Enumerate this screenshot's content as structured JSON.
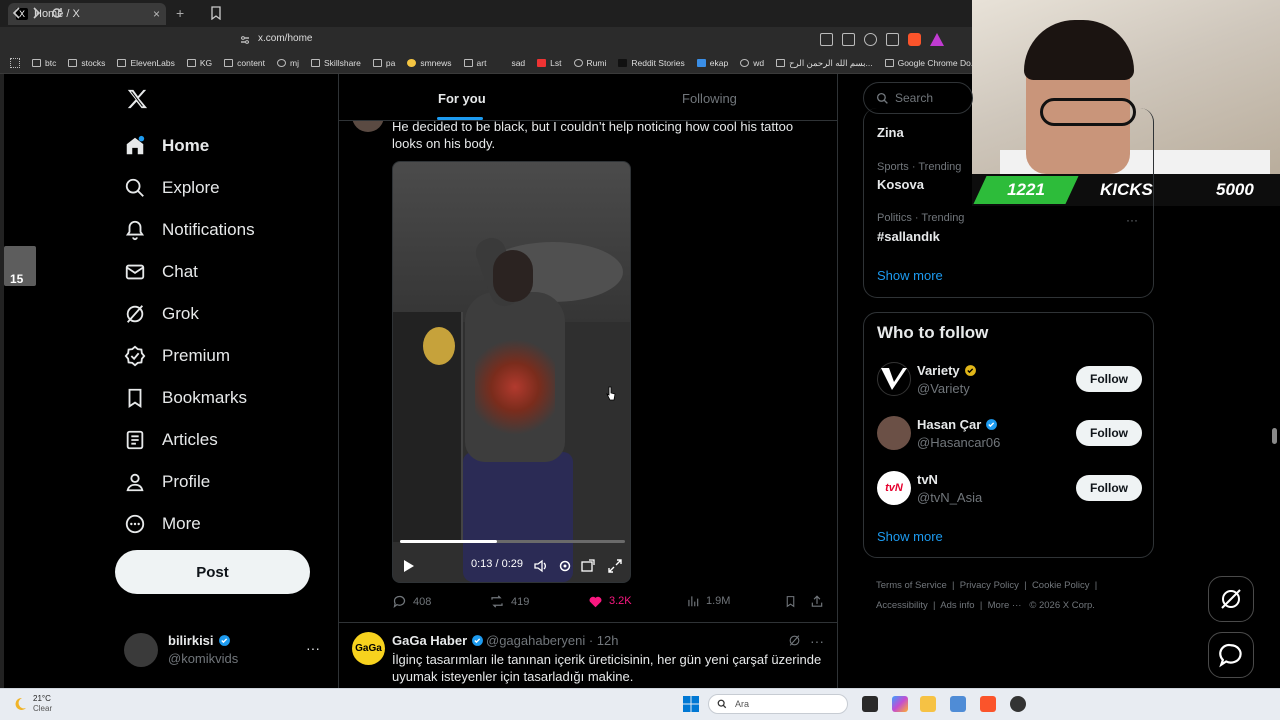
{
  "browser": {
    "tab_title": "Home / X",
    "tab_favicon": "X",
    "tab_close": "×",
    "new_tab": "+",
    "url": "x.com/home",
    "bookmarks": [
      "btc",
      "stocks",
      "ElevenLabs",
      "KG",
      "content",
      "mj",
      "Skillshare",
      "pa",
      "smnews",
      "art",
      "sad",
      "Lst",
      "Rumi",
      "Reddit Stories",
      "ekap",
      "wd",
      "بسم الله الرحمن الرح...",
      "Google Chrome Do..."
    ]
  },
  "stream_overlay": {
    "counter": "1221",
    "label": "KICKS",
    "amount": "5000",
    "colors": {
      "badge": "#2dbc3a"
    }
  },
  "side_thumb": {
    "badge": "15"
  },
  "sidebar": {
    "logo": "X",
    "items": [
      {
        "label": "Home",
        "icon": "home-icon"
      },
      {
        "label": "Explore",
        "icon": "search-icon"
      },
      {
        "label": "Notifications",
        "icon": "bell-icon"
      },
      {
        "label": "Chat",
        "icon": "mail-icon"
      },
      {
        "label": "Grok",
        "icon": "grok-icon"
      },
      {
        "label": "Premium",
        "icon": "verified-icon"
      },
      {
        "label": "Bookmarks",
        "icon": "bookmark-icon"
      },
      {
        "label": "Articles",
        "icon": "article-icon"
      },
      {
        "label": "Profile",
        "icon": "person-icon"
      },
      {
        "label": "More",
        "icon": "more-circle-icon"
      }
    ],
    "post_button": "Post",
    "account": {
      "name": "bilirkisi",
      "handle": "@komikvids",
      "more": "···"
    }
  },
  "feed": {
    "tabs": [
      "For you",
      "Following"
    ],
    "active_tab": "For you",
    "tweet": {
      "text": "He decided to be black, but I couldn’t help noticing how cool his tattoo looks on his body.",
      "video": {
        "time": "0:13 / 0:29",
        "progress": 0.43
      },
      "stats": {
        "replies": "408",
        "reposts": "419",
        "likes": "3.2K",
        "views": "1.9M"
      }
    },
    "tweet2": {
      "name": "GaGa Haber",
      "handle": "@gagahaberyeni · 12h",
      "avatar_text": "GaGa",
      "text": "İlginç tasarımları ile tanınan içerik üreticisinin, her gün yeni çarşaf üzerinde uyumak isteyenler için tasarladığı makine.",
      "more": "···"
    }
  },
  "right": {
    "search_placeholder": "Search",
    "trends": [
      {
        "meta": "",
        "name": "Zina"
      },
      {
        "meta": "Sports · Trending",
        "name": "Kosova"
      },
      {
        "meta": "Politics · Trending",
        "name": "#sallandık"
      }
    ],
    "trends_show_more": "Show more",
    "trend_more": "···",
    "who_to_follow": {
      "title": "Who to follow",
      "users": [
        {
          "name": "Variety",
          "handle": "@Variety",
          "button": "Follow",
          "badge": "gold"
        },
        {
          "name": "Hasan Çar",
          "handle": "@Hasancar06",
          "button": "Follow",
          "badge": "blue"
        },
        {
          "name": "tvN",
          "handle": "@tvN_Asia",
          "button": "Follow",
          "badge": "none"
        }
      ],
      "show_more": "Show more"
    },
    "footer": {
      "links": [
        "Terms of Service",
        "Privacy Policy",
        "Cookie Policy",
        "Accessibility",
        "Ads info",
        "More ···"
      ],
      "copyright": "© 2026 X Corp."
    }
  },
  "taskbar": {
    "weather_temp": "21°C",
    "weather_cond": "Clear",
    "search": "Ara"
  },
  "colors": {
    "accent": "#1d9bf0",
    "like": "#f91880",
    "background": "#000000"
  }
}
